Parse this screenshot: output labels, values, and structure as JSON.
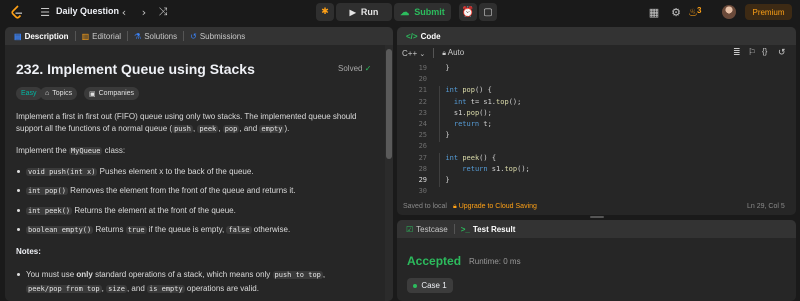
{
  "topbar": {
    "title": "Daily Question",
    "run_label": "Run",
    "submit_label": "Submit",
    "streak": "3",
    "premium_label": "Premium"
  },
  "left": {
    "tabs": [
      "Description",
      "Editorial",
      "Solutions",
      "Submissions"
    ],
    "problem_title": "232. Implement Queue using Stacks",
    "solved_label": "Solved",
    "chips": [
      "Easy",
      "Topics",
      "Companies"
    ],
    "intro_1": "Implement a first in first out (FIFO) queue using only two stacks. The implemented queue should support all the functions of a normal queue (",
    "intro_codes": [
      "push",
      "peek",
      "pop",
      "empty"
    ],
    "intro_seps": [
      ", ",
      ", ",
      ", and ",
      ")."
    ],
    "implement_pre": "Implement the ",
    "implement_code": "MyQueue",
    "implement_post": " class:",
    "bullets": [
      {
        "code": "void push(int x)",
        "text": " Pushes element x to the back of the queue."
      },
      {
        "code": "int pop()",
        "text": " Removes the element from the front of the queue and returns it."
      },
      {
        "code": "int peek()",
        "text": " Returns the element at the front of the queue."
      }
    ],
    "bullet4": {
      "code1": "boolean empty()",
      "mid1": " Returns ",
      "code2": "true",
      "mid2": " if the queue is empty, ",
      "code3": "false",
      "end": " otherwise."
    },
    "notes_label": "Notes:",
    "note1": {
      "pre": "You must use ",
      "bold": "only",
      "mid": " standard operations of a stack, which means only ",
      "code1": "push to top",
      "sep1": ",",
      "code2": "peek/pop from top",
      "sep2": ", ",
      "code3": "size",
      "sep3": ", and ",
      "code4": "is empty",
      "end": " operations are valid."
    }
  },
  "code": {
    "header": "Code",
    "language": "C++",
    "autocomplete": "Auto",
    "line_numbers": [
      "19",
      "20",
      "21",
      "22",
      "23",
      "24",
      "25",
      "26",
      "27",
      "28",
      "29",
      "30"
    ],
    "current_line": "29",
    "status_saved": "Saved to local",
    "upgrade_label": "Upgrade to Cloud Saving",
    "cursor_pos": "Ln 29, Col 5"
  },
  "test": {
    "tab_testcase": "Testcase",
    "tab_result": "Test Result",
    "accepted": "Accepted",
    "runtime": "Runtime: 0 ms",
    "case_label": "Case 1"
  }
}
